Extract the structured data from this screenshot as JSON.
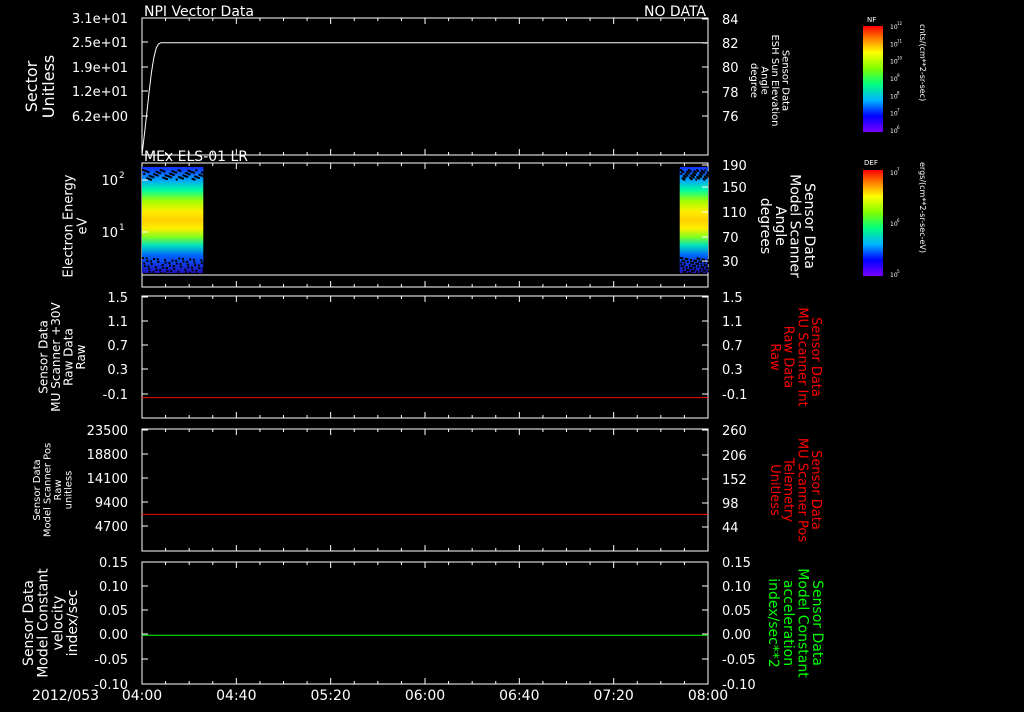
{
  "figure": {
    "date_label": "2012/053",
    "time_ticks": [
      "04:00",
      "04:40",
      "05:20",
      "06:00",
      "06:40",
      "07:20",
      "08:00"
    ]
  },
  "chart_data": [
    {
      "type": "line",
      "panel_title": "NPI Vector Data",
      "status_text": "NO DATA",
      "ylabel_left": [
        "Sector",
        "Unitless"
      ],
      "yticks_left": [
        "3.1e+01",
        "2.5e+01",
        "1.9e+01",
        "1.2e+01",
        "6.2e+00"
      ],
      "ylabel_right": [
        "Sensor Data",
        "ESH Sun Elevation",
        "Angle",
        "degree"
      ],
      "yticks_right": [
        "84",
        "82",
        "80",
        "78",
        "76"
      ],
      "ylim_right": [
        74,
        84
      ],
      "series": [
        {
          "color": "#ffffff",
          "x_minutes": [
            0,
            1,
            2,
            3,
            4,
            5,
            6,
            7,
            8,
            10,
            14,
            20,
            60,
            120,
            180,
            210,
            240
          ],
          "values": [
            74,
            75.5,
            77,
            78.6,
            80,
            81.1,
            81.8,
            82.1,
            82.2,
            82.2,
            82.2,
            82.2,
            82.2,
            82.2,
            82.2,
            82.2,
            82.2
          ]
        }
      ]
    },
    {
      "type": "heatmap",
      "panel_title": "MEx ELS-01 LR",
      "ylabel_left": [
        "Electron Energy",
        "eV"
      ],
      "yticks_left": [
        {
          "label": "10",
          "exp": "2",
          "value": 100
        },
        {
          "label": "10",
          "exp": "1",
          "value": 10
        }
      ],
      "ylabel_right": [
        "Sensor Data",
        "Model Scanner",
        "Angle",
        "degrees"
      ],
      "yticks_right": [
        "190",
        "150",
        "110",
        "70",
        "30"
      ],
      "data_blocks_minutes": [
        [
          0,
          26
        ],
        [
          228,
          240
        ]
      ],
      "colorbar": {
        "title": "DEF",
        "units": "ergs/(cm**2-sr-sec-eV)",
        "ticks": [
          {
            "label": "10",
            "exp": "7"
          },
          {
            "label": "10",
            "exp": "6"
          },
          {
            "label": "10",
            "exp": "5"
          }
        ]
      }
    },
    {
      "type": "line",
      "ylabel_left": [
        "Sensor Data",
        "MU Scanner +30V",
        "Raw Data",
        "Raw"
      ],
      "yticks_left": [
        "1.5",
        "1.1",
        "0.7",
        "0.3",
        "-0.1"
      ],
      "ylabel_right": [
        "Sensor Data",
        "MU Scanner Int",
        "Raw Data",
        "Raw"
      ],
      "yticks_right": [
        "1.5",
        "1.1",
        "0.7",
        "0.3",
        "-0.1"
      ],
      "ylim": [
        -0.3,
        1.5
      ],
      "series": [
        {
          "color": "#ff0000",
          "constant": 0.0
        }
      ]
    },
    {
      "type": "line",
      "ylabel_left": [
        "Sensor Data",
        "Model Scanner Pos",
        "Raw",
        "unitless"
      ],
      "yticks_left": [
        "23500",
        "18800",
        "14100",
        "9400",
        "4700"
      ],
      "ylabel_right": [
        "Sensor Data",
        "MU Scanner Pos",
        "Telemetry",
        "Unitless"
      ],
      "yticks_right": [
        "260",
        "206",
        "152",
        "98",
        "44"
      ],
      "ylim_right": [
        0,
        260
      ],
      "series": [
        {
          "color": "#ff0000",
          "constant": 78
        }
      ]
    },
    {
      "type": "line",
      "ylabel_left": [
        "Sensor Data",
        "Model Constant",
        "velocity",
        "index/sec"
      ],
      "yticks_left": [
        "0.15",
        "0.10",
        "0.05",
        "0.00",
        "-0.05",
        "-0.10"
      ],
      "ylabel_right": [
        "Sensor Data",
        "Model Constant",
        "acceleration",
        "index/sec**2"
      ],
      "yticks_right": [
        "0.15",
        "0.10",
        "0.05",
        "0.00",
        "-0.05",
        "-0.10"
      ],
      "ylim": [
        -0.1,
        0.15
      ],
      "series": [
        {
          "color": "#00ff00",
          "constant": 0.0
        }
      ]
    }
  ],
  "colorbar_top": {
    "title": "NF",
    "units": "cnts/(cm**2-sr-sec)",
    "ticks": [
      {
        "label": "10",
        "exp": "12"
      },
      {
        "label": "10",
        "exp": "11"
      },
      {
        "label": "10",
        "exp": "10"
      },
      {
        "label": "10",
        "exp": "9"
      },
      {
        "label": "10",
        "exp": "8"
      },
      {
        "label": "10",
        "exp": "7"
      },
      {
        "label": "10",
        "exp": "6"
      }
    ]
  },
  "colors": {
    "text": "#ffffff",
    "red_axis": "#ff0000",
    "green_axis": "#00ff00"
  }
}
